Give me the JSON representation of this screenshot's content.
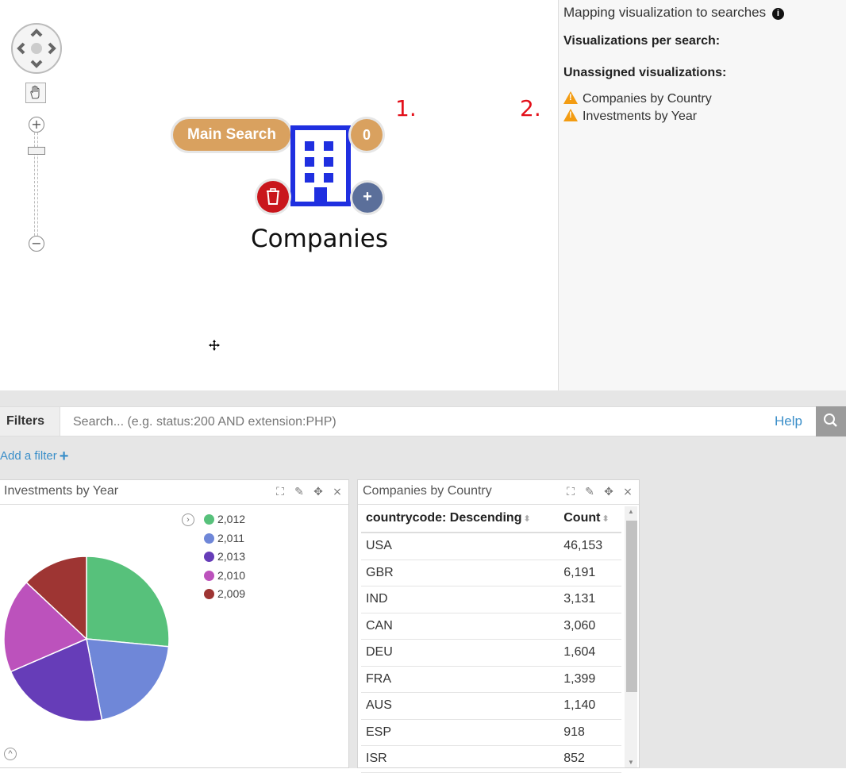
{
  "graph": {
    "node": {
      "label": "Companies",
      "search_badge": "Main Search",
      "count": "0",
      "add_symbol": "+",
      "icon": "building-icon",
      "color": "#1f2fe0"
    },
    "annotations": [
      "1.",
      "2."
    ]
  },
  "right_panel": {
    "title": "Mapping visualization to searches",
    "per_search_heading": "Visualizations per search:",
    "unassigned_heading": "Unassigned visualizations:",
    "unassigned": [
      "Companies by Country",
      "Investments by Year"
    ]
  },
  "filter_bar": {
    "label": "Filters",
    "placeholder": "Search... (e.g. status:200 AND extension:PHP)",
    "help": "Help",
    "add_filter": "Add a filter"
  },
  "pie_panel": {
    "title": "Investments by Year"
  },
  "table_panel": {
    "title": "Companies by Country",
    "columns": [
      "countrycode: Descending",
      "Count"
    ],
    "rows": [
      [
        "USA",
        "46,153"
      ],
      [
        "GBR",
        "6,191"
      ],
      [
        "IND",
        "3,131"
      ],
      [
        "CAN",
        "3,060"
      ],
      [
        "DEU",
        "1,604"
      ],
      [
        "FRA",
        "1,399"
      ],
      [
        "AUS",
        "1,140"
      ],
      [
        "ESP",
        "918"
      ],
      [
        "ISR",
        "852"
      ]
    ]
  },
  "chart_data": {
    "type": "pie",
    "categories": [
      "2,012",
      "2,011",
      "2,013",
      "2,010",
      "2,009"
    ],
    "values": [
      26.5,
      20.5,
      21.5,
      18.5,
      13.0
    ],
    "colors": [
      "#57c17b",
      "#6f87d8",
      "#663db8",
      "#bc52bc",
      "#9e3533"
    ],
    "legend_position": "top-right"
  }
}
